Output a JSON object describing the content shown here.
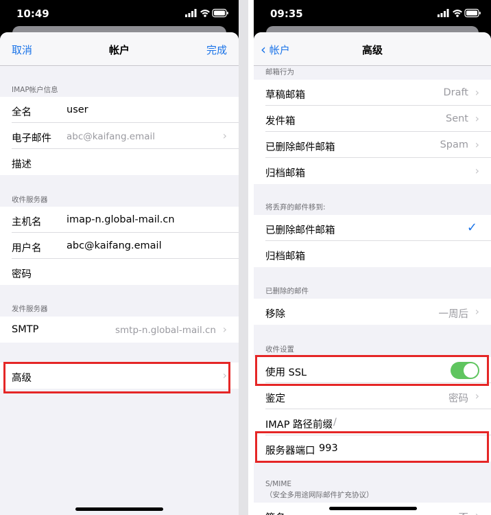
{
  "left": {
    "status_time": "10:49",
    "nav": {
      "cancel": "取消",
      "title": "帐户",
      "done": "完成"
    },
    "imap_header": "IMAP帐户信息",
    "name_label": "全名",
    "name_value": "user",
    "email_label": "电子邮件",
    "email_value": "abc@kaifang.email",
    "desc_label": "描述",
    "incoming_header": "收件服务器",
    "host_label": "主机名",
    "host_value": "imap-n.global-mail.cn",
    "user_label": "用户名",
    "user_value": "abc@kaifang.email",
    "pass_label": "密码",
    "outgoing_header": "发件服务器",
    "smtp_label": "SMTP",
    "smtp_value": "smtp-n.global-mail.cn",
    "advanced_label": "高级"
  },
  "right": {
    "status_time": "09:35",
    "nav": {
      "back": "帐户",
      "title": "高级"
    },
    "mailbox_behavior_header": "邮箱行为",
    "drafts_label": "草稿邮箱",
    "drafts_value": "Draft",
    "sent_label": "发件箱",
    "sent_value": "Sent",
    "deleted_label": "已删除邮件邮箱",
    "deleted_value": "Spam",
    "archive_label": "归档邮箱",
    "move_header": "将丢弃的邮件移到:",
    "move_deleted_label": "已删除邮件邮箱",
    "move_archive_label": "归档邮箱",
    "deleted_mail_header": "已删除的邮件",
    "remove_label": "移除",
    "remove_value": "一周后",
    "incoming_settings_header": "收件设置",
    "ssl_label": "使用 SSL",
    "ssl_on": true,
    "auth_label": "鉴定",
    "auth_value": "密码",
    "prefix_label": "IMAP 路径前缀",
    "prefix_value": "/",
    "port_label": "服务器端口",
    "port_value": "993",
    "smime_header": "S/MIME",
    "smime_sub": "（安全多用途网际邮件扩充协议）",
    "sign_label": "签名",
    "sign_value": "否"
  },
  "colors": {
    "accent": "#1a73e8",
    "highlight": "#e52626",
    "toggle_on": "#5fc55f"
  }
}
